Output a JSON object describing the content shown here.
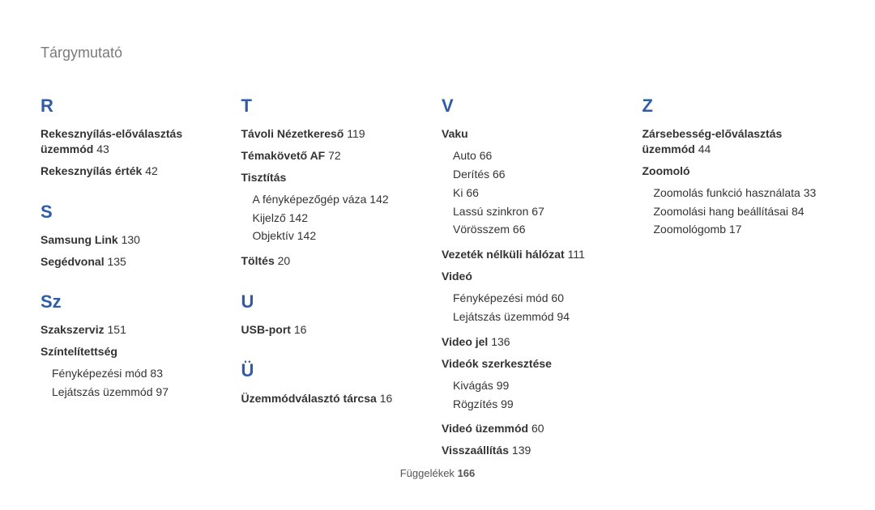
{
  "page_title": "Tárgymutató",
  "footer": {
    "label": "Függelékek",
    "page": "166"
  },
  "col1": {
    "R": {
      "letter": "R",
      "e1": "Rekesznyílás-előválasztás üzemmód",
      "p1": "43",
      "e2": "Rekesznyílás érték",
      "p2": "42"
    },
    "S": {
      "letter": "S",
      "e1": "Samsung Link",
      "p1": "130",
      "e2": "Segédvonal",
      "p2": "135"
    },
    "Sz": {
      "letter": "Sz",
      "e1": "Szakszerviz",
      "p1": "151",
      "e2": "Színtelítettség",
      "s1": "Fényképezési mód",
      "sp1": "83",
      "s2": "Lejátszás üzemmód",
      "sp2": "97"
    }
  },
  "col2": {
    "T": {
      "letter": "T",
      "e1": "Távoli Nézetkereső",
      "p1": "119",
      "e2": "Témakövető AF",
      "p2": "72",
      "e3": "Tisztítás",
      "s1": "A fényképezőgép váza",
      "sp1": "142",
      "s2": "Kijelző",
      "sp2": "142",
      "s3": "Objektív",
      "sp3": "142",
      "e4": "Töltés",
      "p4": "20"
    },
    "U": {
      "letter": "U",
      "e1": "USB-port",
      "p1": "16"
    },
    "Uu": {
      "letter": "Ü",
      "e1": "Üzemmódválasztó tárcsa",
      "p1": "16"
    }
  },
  "col3": {
    "V": {
      "letter": "V",
      "e1": "Vaku",
      "s1": "Auto",
      "sp1": "66",
      "s2": "Derítés",
      "sp2": "66",
      "s3": "Ki",
      "sp3": "66",
      "s4": "Lassú szinkron",
      "sp4": "67",
      "s5": "Vörösszem",
      "sp5": "66",
      "e2": "Vezeték nélküli hálózat",
      "p2": "111",
      "e3": "Videó",
      "s6": "Fényképezési mód",
      "sp6": "60",
      "s7": "Lejátszás üzemmód",
      "sp7": "94",
      "e4": "Video jel",
      "p4": "136",
      "e5": "Videók szerkesztése",
      "s8": "Kivágás",
      "sp8": "99",
      "s9": "Rögzítés",
      "sp9": "99",
      "e6": "Videó üzemmód",
      "p6": "60",
      "e7": "Visszaállítás",
      "p7": "139"
    }
  },
  "col4": {
    "Z": {
      "letter": "Z",
      "e1": "Zársebesség-előválasztás üzemmód",
      "p1": "44",
      "e2": "Zoomoló",
      "s1": "Zoomolás funkció használata",
      "sp1": "33",
      "s2": "Zoomolási hang beállításai",
      "sp2": "84",
      "s3": "Zoomológomb",
      "sp3": "17"
    }
  }
}
